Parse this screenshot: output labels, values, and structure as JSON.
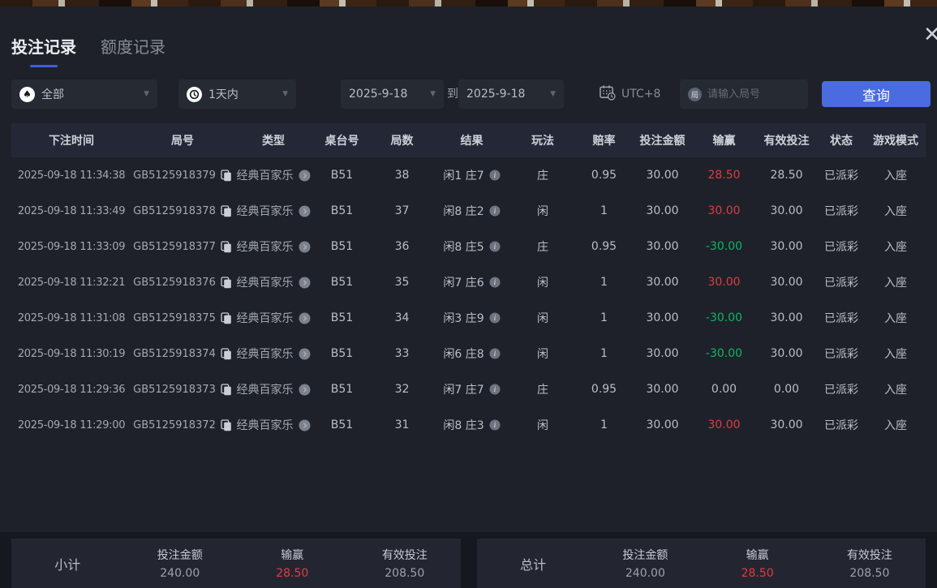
{
  "window": {
    "close_icon": "✕"
  },
  "tabs": [
    {
      "label": "投注记录"
    },
    {
      "label": "额度记录"
    }
  ],
  "filters": {
    "game_type": "全部",
    "time_range": "1天内",
    "date_from": "2025-9-18",
    "to_label": "到",
    "date_to": "2025-9-18",
    "timezone": "UTC+8",
    "round_placeholder": "请输入局号",
    "search_button": "查询"
  },
  "table": {
    "headers": [
      "下注时间",
      "局号",
      "类型",
      "桌台号",
      "局数",
      "结果",
      "玩法",
      "赔率",
      "投注金额",
      "输赢",
      "有效投注",
      "状态",
      "游戏模式"
    ],
    "rows": [
      {
        "time": "2025-09-18 11:34:38",
        "round_id": "GB5125918379",
        "game_type": "经典百家乐",
        "table_no": "B51",
        "round_no": "38",
        "result": "闲1 庄7",
        "bet_on": "庄",
        "odds": "0.95",
        "bet_amount": "30.00",
        "win_loss": "28.50",
        "win_loss_state": "win",
        "valid_bet": "28.50",
        "status": "已派彩",
        "mode": "入座"
      },
      {
        "time": "2025-09-18 11:33:49",
        "round_id": "GB5125918378",
        "game_type": "经典百家乐",
        "table_no": "B51",
        "round_no": "37",
        "result": "闲8 庄2",
        "bet_on": "闲",
        "odds": "1",
        "bet_amount": "30.00",
        "win_loss": "30.00",
        "win_loss_state": "win",
        "valid_bet": "30.00",
        "status": "已派彩",
        "mode": "入座"
      },
      {
        "time": "2025-09-18 11:33:09",
        "round_id": "GB5125918377",
        "game_type": "经典百家乐",
        "table_no": "B51",
        "round_no": "36",
        "result": "闲8 庄5",
        "bet_on": "庄",
        "odds": "0.95",
        "bet_amount": "30.00",
        "win_loss": "-30.00",
        "win_loss_state": "loss",
        "valid_bet": "30.00",
        "status": "已派彩",
        "mode": "入座"
      },
      {
        "time": "2025-09-18 11:32:21",
        "round_id": "GB5125918376",
        "game_type": "经典百家乐",
        "table_no": "B51",
        "round_no": "35",
        "result": "闲7 庄6",
        "bet_on": "闲",
        "odds": "1",
        "bet_amount": "30.00",
        "win_loss": "30.00",
        "win_loss_state": "win",
        "valid_bet": "30.00",
        "status": "已派彩",
        "mode": "入座"
      },
      {
        "time": "2025-09-18 11:31:08",
        "round_id": "GB5125918375",
        "game_type": "经典百家乐",
        "table_no": "B51",
        "round_no": "34",
        "result": "闲3 庄9",
        "bet_on": "闲",
        "odds": "1",
        "bet_amount": "30.00",
        "win_loss": "-30.00",
        "win_loss_state": "loss",
        "valid_bet": "30.00",
        "status": "已派彩",
        "mode": "入座"
      },
      {
        "time": "2025-09-18 11:30:19",
        "round_id": "GB5125918374",
        "game_type": "经典百家乐",
        "table_no": "B51",
        "round_no": "33",
        "result": "闲6 庄8",
        "bet_on": "闲",
        "odds": "1",
        "bet_amount": "30.00",
        "win_loss": "-30.00",
        "win_loss_state": "loss",
        "valid_bet": "30.00",
        "status": "已派彩",
        "mode": "入座"
      },
      {
        "time": "2025-09-18 11:29:36",
        "round_id": "GB5125918373",
        "game_type": "经典百家乐",
        "table_no": "B51",
        "round_no": "32",
        "result": "闲7 庄7",
        "bet_on": "庄",
        "odds": "0.95",
        "bet_amount": "30.00",
        "win_loss": "0.00",
        "win_loss_state": "zero",
        "valid_bet": "0.00",
        "status": "已派彩",
        "mode": "入座"
      },
      {
        "time": "2025-09-18 11:29:00",
        "round_id": "GB5125918372",
        "game_type": "经典百家乐",
        "table_no": "B51",
        "round_no": "31",
        "result": "闲8 庄3",
        "bet_on": "闲",
        "odds": "1",
        "bet_amount": "30.00",
        "win_loss": "30.00",
        "win_loss_state": "win",
        "valid_bet": "30.00",
        "status": "已派彩",
        "mode": "入座"
      }
    ]
  },
  "summary": {
    "subtotal_label": "小计",
    "total_label": "总计",
    "bet_amount_label": "投注金额",
    "win_loss_label": "输赢",
    "valid_bet_label": "有效投注",
    "subtotal": {
      "bet_amount": "240.00",
      "win_loss": "28.50",
      "valid_bet": "208.50"
    },
    "total": {
      "bet_amount": "240.00",
      "win_loss": "28.50",
      "valid_bet": "208.50"
    }
  },
  "colors": {
    "accent_blue": "#4a6ce0",
    "win_red": "#e03c40",
    "loss_green": "#0ab864"
  }
}
